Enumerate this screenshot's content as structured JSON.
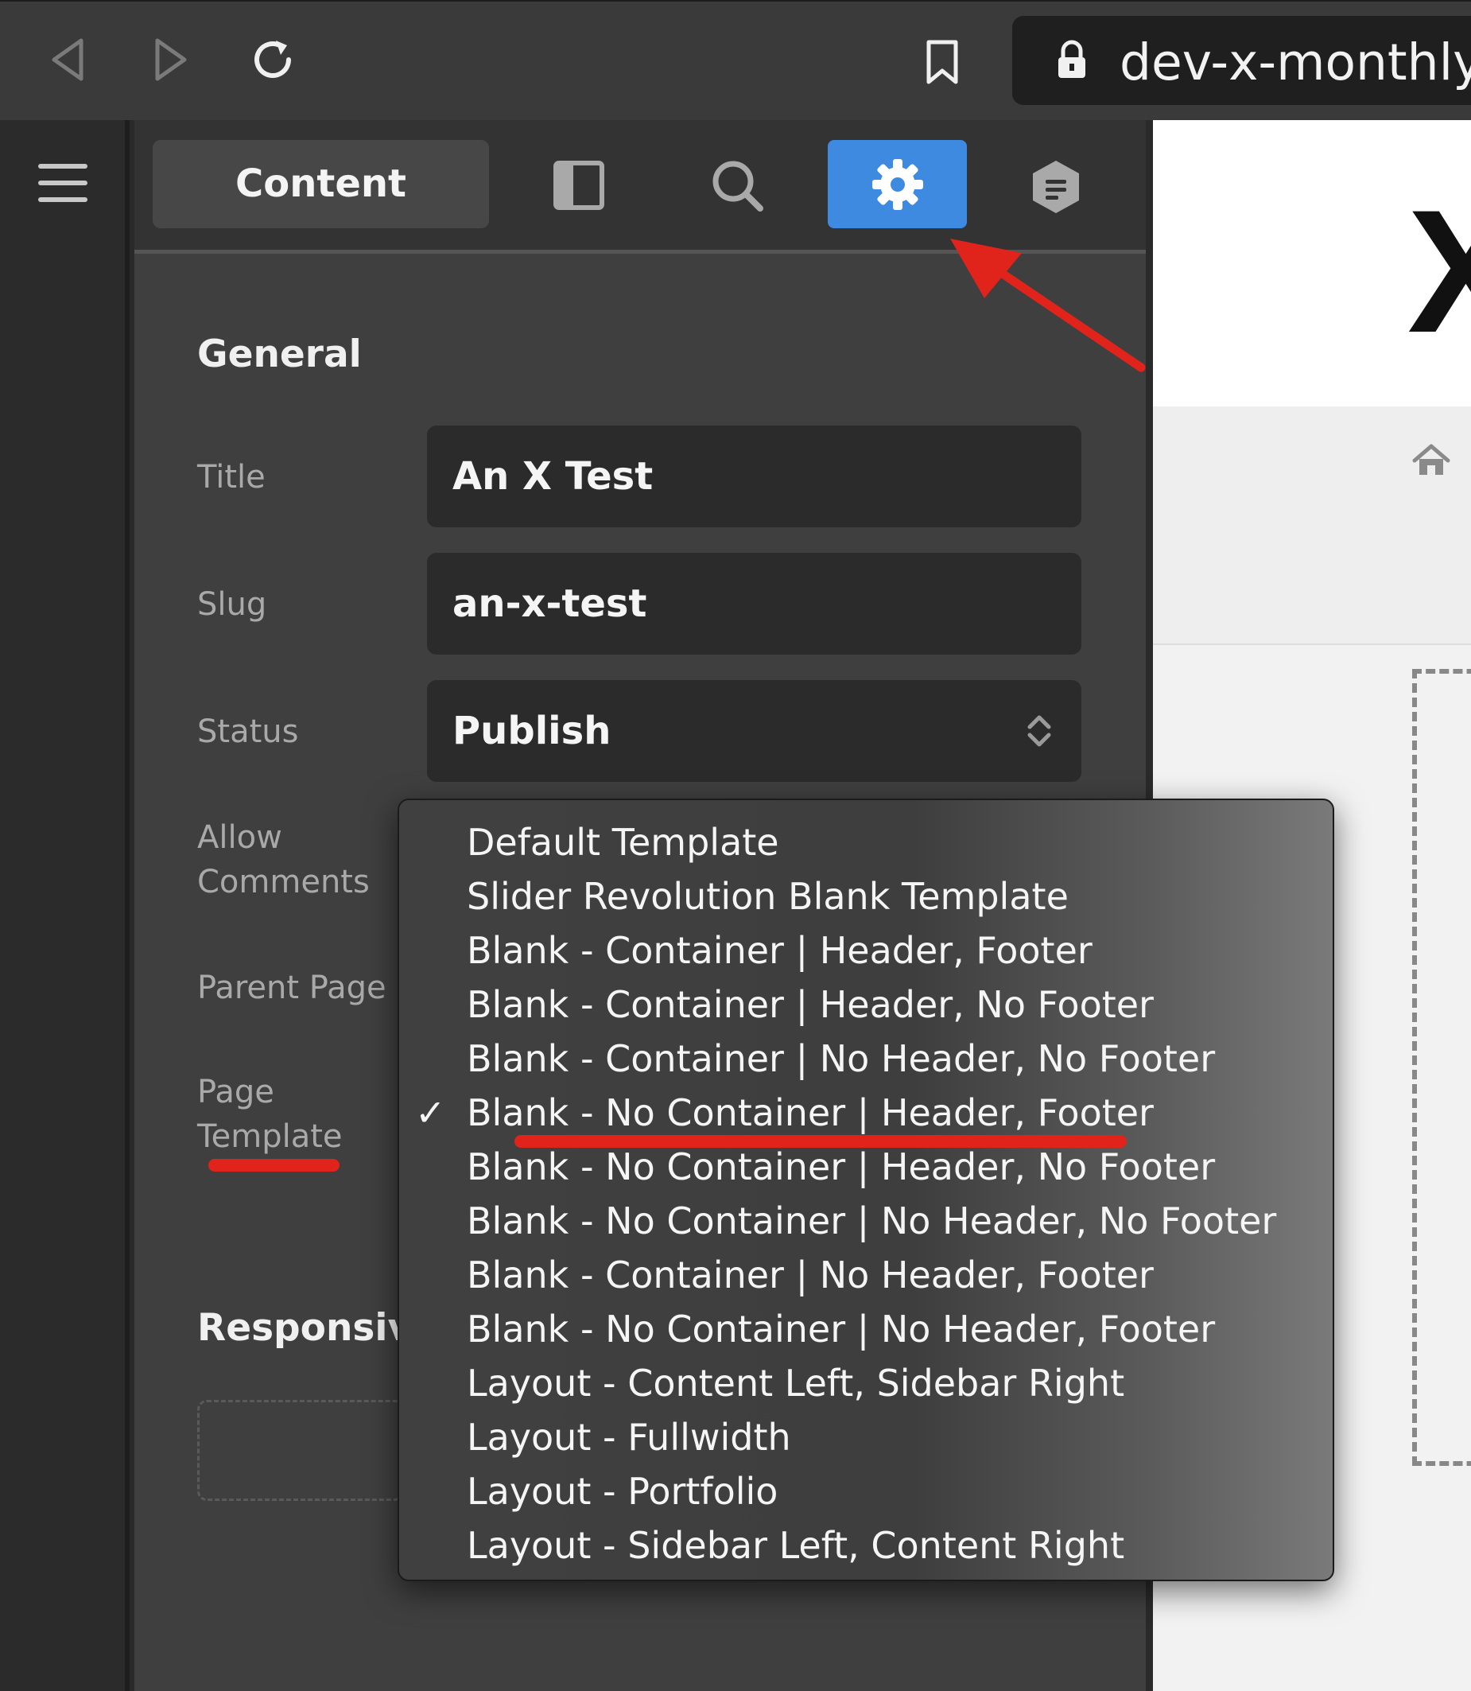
{
  "browser": {
    "url": "dev-x-monthly-d",
    "icons": [
      "back-arrow-icon",
      "forward-arrow-icon",
      "reload-icon",
      "bookmark-icon",
      "lock-icon"
    ]
  },
  "sidebar_panel": {
    "tabs": {
      "content_label": "Content",
      "active_tab": "settings"
    },
    "general": {
      "section_title": "General",
      "title_label": "Title",
      "title_value": "An X Test",
      "slug_label": "Slug",
      "slug_value": "an-x-test",
      "status_label": "Status",
      "status_value": "Publish",
      "allow_comments_label_line1": "Allow",
      "allow_comments_label_line2": "Comments",
      "parent_page_label": "Parent Page",
      "page_template_label_line1": "Page",
      "page_template_label_line2": "Template"
    },
    "responsive_title": "Responsiv"
  },
  "template_dropdown": {
    "selected": "Blank - No Container | Header, Footer",
    "options": [
      "Default Template",
      "Slider Revolution Blank Template",
      "Blank - Container | Header, Footer",
      "Blank - Container | Header, No Footer",
      "Blank - Container | No Header, No Footer",
      "Blank - No Container | Header, Footer",
      "Blank - No Container | Header, No Footer",
      "Blank - No Container | No Header, No Footer",
      "Blank - Container | No Header, Footer",
      "Blank - No Container | No Header, Footer",
      "Layout - Content Left, Sidebar Right",
      "Layout - Fullwidth",
      "Layout - Portfolio",
      "Layout - Sidebar Left, Content Right"
    ],
    "check_mark": "✓"
  },
  "preview": {
    "heading_fragment": "X"
  },
  "colors": {
    "accent": "#3d8ae0",
    "annotation_red": "#e0241b"
  }
}
